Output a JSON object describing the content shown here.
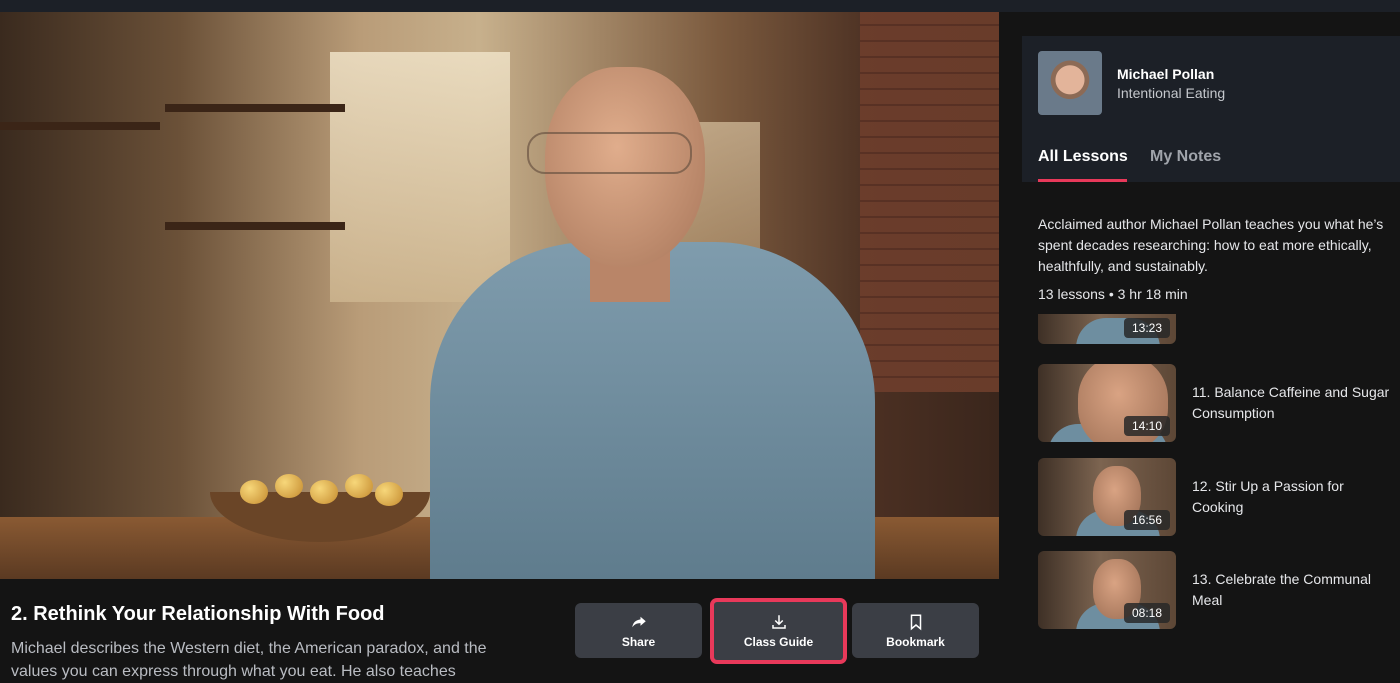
{
  "video": {
    "title": "2. Rethink Your Relationship With Food",
    "description": "Michael describes the Western diet, the American paradox, and the values you can express through what you eat. He also teaches"
  },
  "actions": {
    "share_label": "Share",
    "class_guide_label": "Class Guide",
    "bookmark_label": "Bookmark",
    "highlight_color": "#e8395a"
  },
  "instructor": {
    "name": "Michael Pollan",
    "course": "Intentional Eating"
  },
  "tabs": [
    {
      "label": "All Lessons",
      "active": true
    },
    {
      "label": "My Notes",
      "active": false
    }
  ],
  "about": {
    "text": "Acclaimed author Michael Pollan teaches you what he’s spent decades researching: how to eat more ethically, healthfully, and sustainably.",
    "meta": "13 lessons • 3 hr 18 min"
  },
  "lessons": [
    {
      "title": "",
      "duration": "13:23"
    },
    {
      "title": "11. Balance Caffeine and Sugar Consumption",
      "duration": "14:10"
    },
    {
      "title": "12. Stir Up a Passion for Cooking",
      "duration": "16:56"
    },
    {
      "title": "13. Celebrate the Communal Meal",
      "duration": "08:18"
    }
  ]
}
